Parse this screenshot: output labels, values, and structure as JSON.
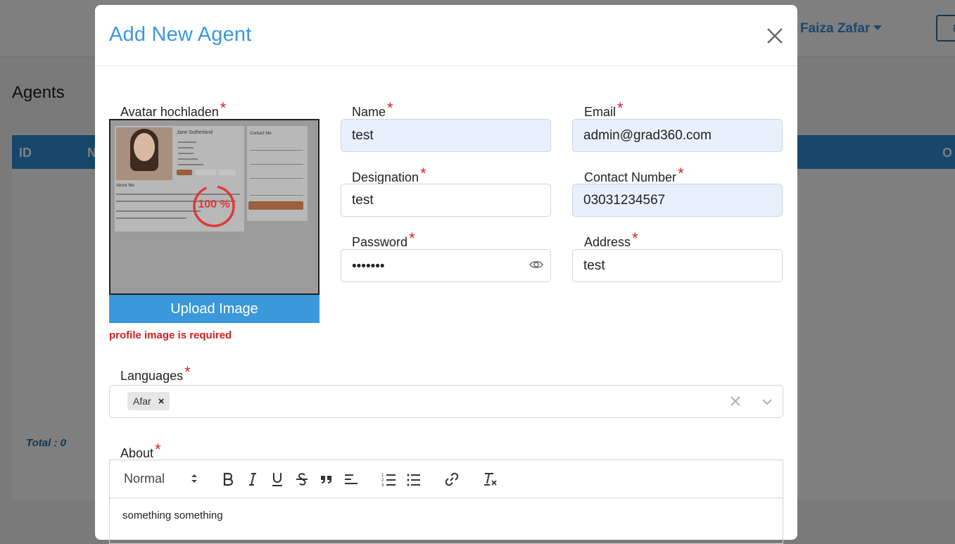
{
  "background": {
    "user_name": "Faiza Zafar",
    "top_button_label": "E",
    "page_title": "Agents",
    "table_headers": [
      "ID",
      "N",
      "O"
    ],
    "total_label": "Total : 0"
  },
  "modal": {
    "title": "Add New Agent",
    "avatar": {
      "label": "Avatar hochladen",
      "progress_percent": 100,
      "progress_text": "100 %",
      "upload_button": "Upload Image",
      "error": "profile image is required",
      "preview_name": "Jane Sutherland",
      "preview_about": "About Me",
      "preview_contact": "Contact Me"
    },
    "fields": {
      "name": {
        "label": "Name",
        "value": "test"
      },
      "email": {
        "label": "Email",
        "value": "admin@grad360.com"
      },
      "designation": {
        "label": "Designation",
        "value": "test"
      },
      "contact": {
        "label": "Contact Number",
        "value": "03031234567"
      },
      "password": {
        "label": "Password",
        "value": "•••••••"
      },
      "address": {
        "label": "Address",
        "value": "test"
      }
    },
    "required_marker": "*",
    "languages": {
      "label": "Languages",
      "selected": [
        "Afar"
      ],
      "remove_glyph": "×"
    },
    "about": {
      "label": "About",
      "format_select": "Normal",
      "content": "something something"
    }
  },
  "colors": {
    "accent": "#3a98db",
    "required": "#e52020",
    "error": "#d61f1f",
    "autofill": "#e8f0fe"
  }
}
